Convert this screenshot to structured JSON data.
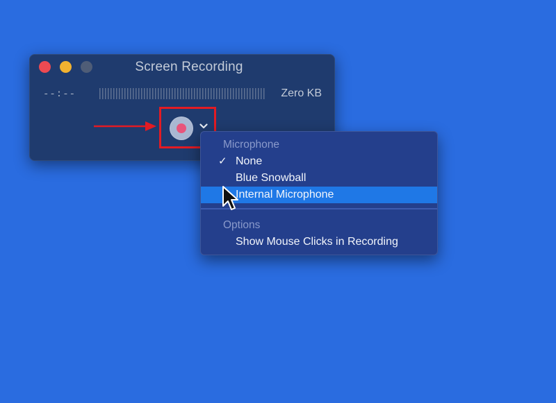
{
  "window": {
    "title": "Screen Recording",
    "time": "--:--",
    "file_size": "Zero KB",
    "controls": {
      "close_color": "#ed4a52",
      "minimize_color": "#f2b230",
      "zoom_color": "#4f5d77"
    },
    "record_button_icon": "record-circle-icon",
    "options_icon": "chevron-down-icon"
  },
  "menu": {
    "microphone_header": "Microphone",
    "microphone_items": [
      {
        "label": "None",
        "checked": true
      },
      {
        "label": "Blue Snowball",
        "checked": false
      },
      {
        "label": "Internal Microphone",
        "checked": false,
        "highlighted": true
      }
    ],
    "options_header": "Options",
    "options_items": [
      {
        "label": "Show Mouse Clicks in Recording"
      }
    ],
    "checkmark": "✓"
  },
  "colors": {
    "desktop": "#2a6ce0",
    "highlight": "#1f78e6",
    "annotation": "#e31b23"
  }
}
